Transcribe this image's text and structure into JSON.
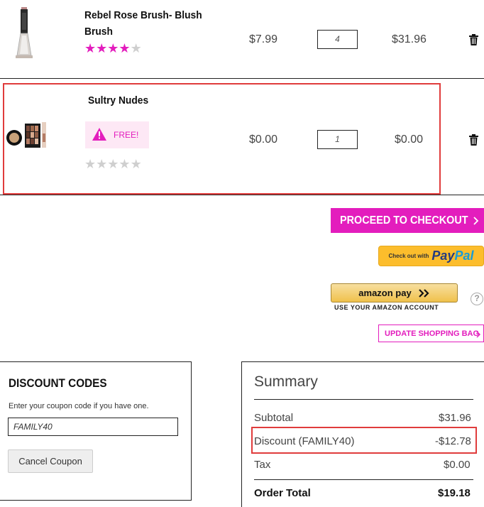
{
  "items": [
    {
      "name_line1": "Rebel Rose Brush- Blush",
      "name_line2": "Brush",
      "rating_stars": 4,
      "rating_max": 5,
      "price": "$7.99",
      "qty": "4",
      "total": "$31.96",
      "remove_icon": "trash-icon"
    },
    {
      "name_line1": "Sultry Nudes",
      "badge": "FREE!",
      "badge_icon": "warning-icon",
      "rating_stars": 0,
      "rating_max": 5,
      "price": "$0.00",
      "qty": "1",
      "total": "$0.00",
      "remove_icon": "trash-icon"
    }
  ],
  "actions": {
    "checkout_label": "PROCEED TO CHECKOUT",
    "checkout_icon": "chevron-right-icon",
    "paypal_small": "Check out with",
    "paypal_pay": "Pay",
    "paypal_pal": "Pal",
    "amazon_label": "amazon pay",
    "amazon_sub": "USE YOUR AMAZON ACCOUNT",
    "help_symbol": "?",
    "update_label": "UPDATE SHOPPING BAG"
  },
  "discount": {
    "title": "DISCOUNT CODES",
    "help": "Enter your coupon code if you have one.",
    "code": "FAMILY40",
    "cancel_label": "Cancel Coupon"
  },
  "summary": {
    "title": "Summary",
    "subtotal_label": "Subtotal",
    "subtotal_value": "$31.96",
    "discount_label": "Discount (FAMILY40)",
    "discount_value": "-$12.78",
    "tax_label": "Tax",
    "tax_value": "$0.00",
    "total_label": "Order Total",
    "total_value": "$19.18"
  },
  "colors": {
    "accent": "#e31dbd",
    "highlight": "#e03c3c",
    "paypal_yellow": "#fcbd2c"
  }
}
